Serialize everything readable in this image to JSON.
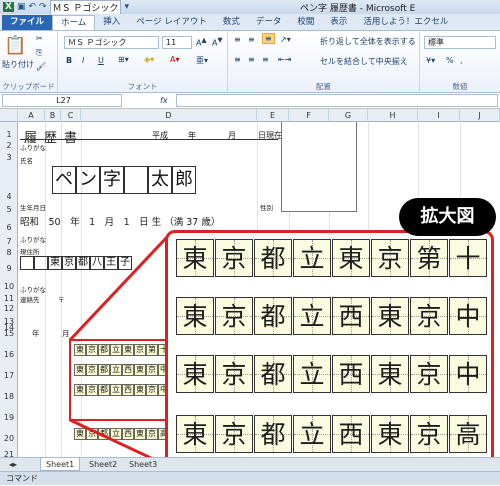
{
  "window": {
    "title": "ペン字 履歴書 - Microsoft E"
  },
  "tabs": [
    "ファイル",
    "ホーム",
    "挿入",
    "ページ レイアウト",
    "数式",
    "データ",
    "校閲",
    "表示",
    "活用しよう！エクセル"
  ],
  "ribbon": {
    "font_name": "ＭＳ Ｐゴシック",
    "font_size": "11",
    "paste": "貼り付け",
    "clipboard": "クリップボード",
    "font_group": "フォント",
    "wrap": "折り返して全体を表示する",
    "merge": "セルを結合して中央揃え",
    "align_group": "配置",
    "number_format": "標準",
    "number_group": "数値",
    "bold": "B",
    "italic": "I",
    "underline": "U",
    "pct": "%",
    "comma": ","
  },
  "formula_bar": {
    "name_box": "L27",
    "fx": "fx"
  },
  "columns": [
    "A",
    "B",
    "C",
    "D",
    "E",
    "F",
    "G",
    "H",
    "I",
    "J"
  ],
  "rows": [
    "1",
    "2",
    "3",
    "4",
    "5",
    "6",
    "7",
    "8",
    "9",
    "10",
    "11",
    "12",
    "13",
    "14",
    "15",
    "16",
    "17",
    "18",
    "19",
    "20",
    "21"
  ],
  "sheet": {
    "heading": "履歴書",
    "heisei": "平成",
    "year": "年",
    "month": "月",
    "day_current": "日現在",
    "furigana": "ふりがな",
    "name_label": "氏名",
    "name_chars": [
      "ペ",
      "ン",
      "字",
      "",
      "太",
      "郎"
    ],
    "birth_label": "生年月日",
    "birth_text": "昭和　50　年　1　月　1　日 生 （満 37 歳）",
    "sex": "性別",
    "address_label": "現住所",
    "address_chars": [
      "",
      "",
      "東",
      "京",
      "都",
      "八",
      "王",
      "子"
    ],
    "contact_label": "連絡先",
    "contact_prefix": "〒",
    "history_year": "年",
    "history_month": "月",
    "mini_rows": [
      [
        "東",
        "京",
        "都",
        "立",
        "東",
        "京",
        "第",
        "十"
      ],
      [
        "東",
        "京",
        "都",
        "立",
        "西",
        "東",
        "京",
        "中"
      ],
      [
        "東",
        "京",
        "都",
        "立",
        "西",
        "東",
        "京",
        "中"
      ],
      [
        "東",
        "京",
        "都",
        "立",
        "西",
        "東",
        "京",
        "高"
      ]
    ]
  },
  "zoom": {
    "badge": "拡大図",
    "rows": [
      [
        "東",
        "京",
        "都",
        "立",
        "東",
        "京",
        "第",
        "十"
      ],
      [
        "東",
        "京",
        "都",
        "立",
        "西",
        "東",
        "京",
        "中"
      ],
      [
        "東",
        "京",
        "都",
        "立",
        "西",
        "東",
        "京",
        "中"
      ],
      [
        "東",
        "京",
        "都",
        "立",
        "西",
        "東",
        "京",
        "高"
      ]
    ]
  },
  "sheet_tabs": [
    "Sheet1",
    "Sheet2",
    "Sheet3"
  ],
  "status": "コマンド"
}
